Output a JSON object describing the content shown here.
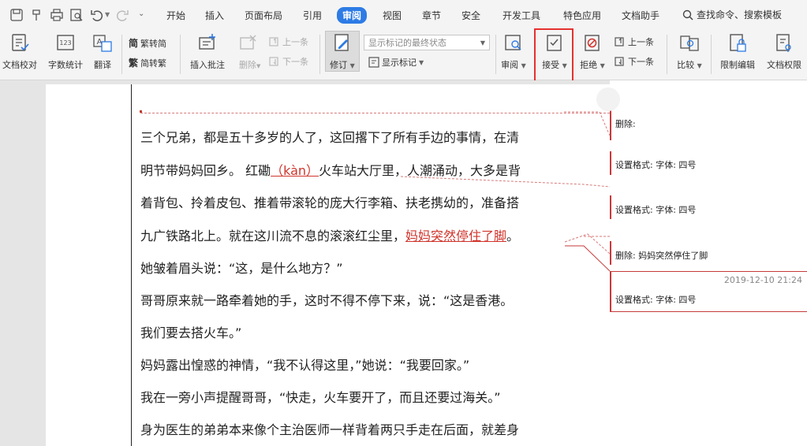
{
  "menu": {
    "tabs": [
      "开始",
      "插入",
      "页面布局",
      "引用",
      "审阅",
      "视图",
      "章节",
      "安全",
      "开发工具",
      "特色应用",
      "文档助手"
    ],
    "active_tab": "审阅",
    "search_label": "查找命令、搜索模板"
  },
  "ribbon": {
    "proofread": "文档校对",
    "word_count": "字数统计",
    "translate": "翻译",
    "trad_to_simp": "繁转简",
    "simp_to_trad": "简转繁",
    "insert_comment": "插入批注",
    "delete": "删除",
    "prev_comment": "上一条",
    "next_comment": "下一条",
    "track_changes": "修订",
    "display_mode_value": "显示标记的最终状态",
    "show_markup": "显示标记",
    "review": "审阅",
    "accept": "接受",
    "reject": "拒绝",
    "prev_change": "上一条",
    "next_change": "下一条",
    "compare": "比较",
    "restrict_editing": "限制编辑",
    "document_rights": "文档权限"
  },
  "document": {
    "l1": "三个兄弟，都是五十多岁的人了，这回撂下了所有手边的事情，在清",
    "l2a": "明节带妈妈回乡。 红磡",
    "l2b": "（kàn）",
    "l2c": "火车站大厅里，人潮涌动，大多是背",
    "l3": "着背包、拎着皮包、推着带滚轮的庞大行李箱、扶老携幼的，准备搭",
    "l4a": "九广铁路北上。就在这川流不息的滚滚红尘里，",
    "l4b": "妈妈突然停住了脚",
    "l4c": "。",
    "l5": "她皱着眉头说：“这，是什么地方？”",
    "l6": "哥哥原来就一路牵着她的手，这时不得不停下来，说：“这是香港。",
    "l7": "我们要去搭火车。”",
    "l8": "妈妈露出惶惑的神情，“我不认得这里，”她说：“我要回家。”",
    "l9": "我在一旁小声提醒哥哥，“快走，火车要开了，而且还要过海关。”",
    "l10": "身为医生的弟弟本来像个主治医师一样背着两只手走在后面，就差身"
  },
  "balloons": [
    {
      "text": "删除:"
    },
    {
      "text": "设置格式: 字体: 四号"
    },
    {
      "text": "设置格式: 字体: 四号"
    },
    {
      "text": "删除: 妈妈突然停住了脚"
    },
    {
      "text": "设置格式: 字体: 四号",
      "time": "2019-12-10 21:24"
    }
  ]
}
